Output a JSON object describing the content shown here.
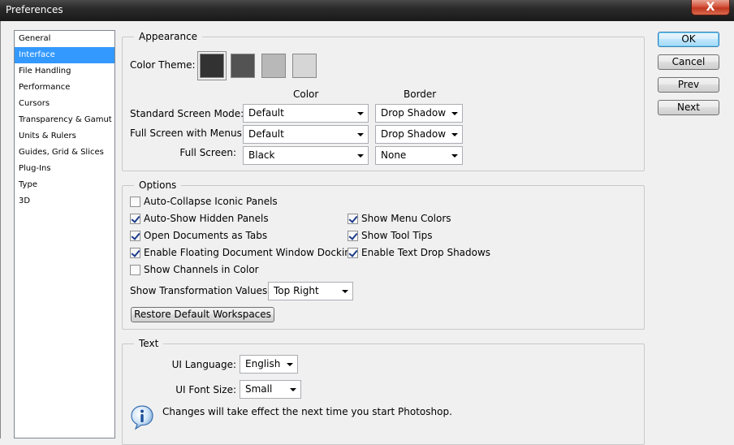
{
  "window": {
    "title": "Preferences",
    "close_label": "X"
  },
  "categories": [
    {
      "label": "General"
    },
    {
      "label": "Interface",
      "selected": true
    },
    {
      "label": "File Handling"
    },
    {
      "label": "Performance"
    },
    {
      "label": "Cursors"
    },
    {
      "label": "Transparency & Gamut"
    },
    {
      "label": "Units & Rulers"
    },
    {
      "label": "Guides, Grid & Slices"
    },
    {
      "label": "Plug-Ins"
    },
    {
      "label": "Type"
    },
    {
      "label": "3D"
    }
  ],
  "appearance": {
    "title": "Appearance",
    "color_theme_label": "Color Theme:",
    "themes": [
      {
        "name": "darkest",
        "color": "#323232"
      },
      {
        "name": "dark",
        "color": "#535353"
      },
      {
        "name": "medium",
        "color": "#b8b8b8"
      },
      {
        "name": "light",
        "color": "#d6d6d6"
      }
    ],
    "col_color": "Color",
    "col_border": "Border",
    "rows": [
      {
        "label": "Standard Screen Mode:",
        "color": "Default",
        "border": "Drop Shadow"
      },
      {
        "label": "Full Screen with Menus:",
        "color": "Default",
        "border": "Drop Shadow"
      },
      {
        "label": "Full Screen:",
        "color": "Black",
        "border": "None"
      }
    ]
  },
  "options": {
    "title": "Options",
    "auto_collapse": {
      "label": "Auto-Collapse Iconic Panels",
      "checked": false
    },
    "auto_show": {
      "label": "Auto-Show Hidden Panels",
      "checked": true
    },
    "open_tabs": {
      "label": "Open Documents as Tabs",
      "checked": true
    },
    "floating_docking": {
      "label": "Enable Floating Document Window Docking",
      "checked": true
    },
    "channels_color": {
      "label": "Show Channels in Color",
      "checked": false
    },
    "menu_colors": {
      "label": "Show Menu Colors",
      "checked": true
    },
    "tool_tips": {
      "label": "Show Tool Tips",
      "checked": true
    },
    "text_shadows": {
      "label": "Enable Text Drop Shadows",
      "checked": true
    },
    "transform_label": "Show Transformation Values:",
    "transform_value": "Top Right",
    "restore_button": "Restore Default Workspaces"
  },
  "text_section": {
    "title": "Text",
    "language_label": "UI Language:",
    "language_value": "English",
    "font_size_label": "UI Font Size:",
    "font_size_value": "Small",
    "notice": "Changes will take effect the next time you start Photoshop."
  },
  "buttons": {
    "ok": "OK",
    "cancel": "Cancel",
    "prev": "Prev",
    "next": "Next"
  }
}
